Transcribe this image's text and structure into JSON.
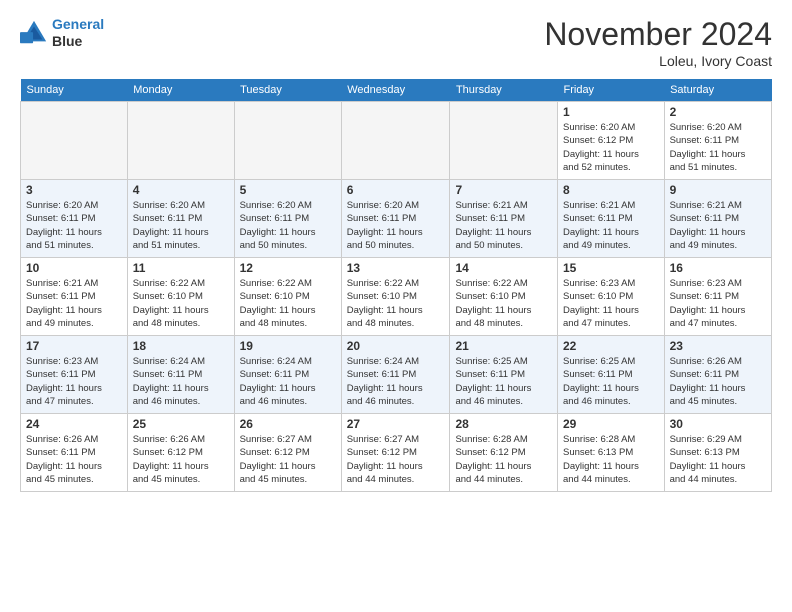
{
  "header": {
    "logo_line1": "General",
    "logo_line2": "Blue",
    "month_title": "November 2024",
    "location": "Loleu, Ivory Coast"
  },
  "weekdays": [
    "Sunday",
    "Monday",
    "Tuesday",
    "Wednesday",
    "Thursday",
    "Friday",
    "Saturday"
  ],
  "weeks": [
    [
      {
        "day": "",
        "info": ""
      },
      {
        "day": "",
        "info": ""
      },
      {
        "day": "",
        "info": ""
      },
      {
        "day": "",
        "info": ""
      },
      {
        "day": "",
        "info": ""
      },
      {
        "day": "1",
        "info": "Sunrise: 6:20 AM\nSunset: 6:12 PM\nDaylight: 11 hours\nand 52 minutes."
      },
      {
        "day": "2",
        "info": "Sunrise: 6:20 AM\nSunset: 6:11 PM\nDaylight: 11 hours\nand 51 minutes."
      }
    ],
    [
      {
        "day": "3",
        "info": "Sunrise: 6:20 AM\nSunset: 6:11 PM\nDaylight: 11 hours\nand 51 minutes."
      },
      {
        "day": "4",
        "info": "Sunrise: 6:20 AM\nSunset: 6:11 PM\nDaylight: 11 hours\nand 51 minutes."
      },
      {
        "day": "5",
        "info": "Sunrise: 6:20 AM\nSunset: 6:11 PM\nDaylight: 11 hours\nand 50 minutes."
      },
      {
        "day": "6",
        "info": "Sunrise: 6:20 AM\nSunset: 6:11 PM\nDaylight: 11 hours\nand 50 minutes."
      },
      {
        "day": "7",
        "info": "Sunrise: 6:21 AM\nSunset: 6:11 PM\nDaylight: 11 hours\nand 50 minutes."
      },
      {
        "day": "8",
        "info": "Sunrise: 6:21 AM\nSunset: 6:11 PM\nDaylight: 11 hours\nand 49 minutes."
      },
      {
        "day": "9",
        "info": "Sunrise: 6:21 AM\nSunset: 6:11 PM\nDaylight: 11 hours\nand 49 minutes."
      }
    ],
    [
      {
        "day": "10",
        "info": "Sunrise: 6:21 AM\nSunset: 6:11 PM\nDaylight: 11 hours\nand 49 minutes."
      },
      {
        "day": "11",
        "info": "Sunrise: 6:22 AM\nSunset: 6:10 PM\nDaylight: 11 hours\nand 48 minutes."
      },
      {
        "day": "12",
        "info": "Sunrise: 6:22 AM\nSunset: 6:10 PM\nDaylight: 11 hours\nand 48 minutes."
      },
      {
        "day": "13",
        "info": "Sunrise: 6:22 AM\nSunset: 6:10 PM\nDaylight: 11 hours\nand 48 minutes."
      },
      {
        "day": "14",
        "info": "Sunrise: 6:22 AM\nSunset: 6:10 PM\nDaylight: 11 hours\nand 48 minutes."
      },
      {
        "day": "15",
        "info": "Sunrise: 6:23 AM\nSunset: 6:10 PM\nDaylight: 11 hours\nand 47 minutes."
      },
      {
        "day": "16",
        "info": "Sunrise: 6:23 AM\nSunset: 6:11 PM\nDaylight: 11 hours\nand 47 minutes."
      }
    ],
    [
      {
        "day": "17",
        "info": "Sunrise: 6:23 AM\nSunset: 6:11 PM\nDaylight: 11 hours\nand 47 minutes."
      },
      {
        "day": "18",
        "info": "Sunrise: 6:24 AM\nSunset: 6:11 PM\nDaylight: 11 hours\nand 46 minutes."
      },
      {
        "day": "19",
        "info": "Sunrise: 6:24 AM\nSunset: 6:11 PM\nDaylight: 11 hours\nand 46 minutes."
      },
      {
        "day": "20",
        "info": "Sunrise: 6:24 AM\nSunset: 6:11 PM\nDaylight: 11 hours\nand 46 minutes."
      },
      {
        "day": "21",
        "info": "Sunrise: 6:25 AM\nSunset: 6:11 PM\nDaylight: 11 hours\nand 46 minutes."
      },
      {
        "day": "22",
        "info": "Sunrise: 6:25 AM\nSunset: 6:11 PM\nDaylight: 11 hours\nand 46 minutes."
      },
      {
        "day": "23",
        "info": "Sunrise: 6:26 AM\nSunset: 6:11 PM\nDaylight: 11 hours\nand 45 minutes."
      }
    ],
    [
      {
        "day": "24",
        "info": "Sunrise: 6:26 AM\nSunset: 6:11 PM\nDaylight: 11 hours\nand 45 minutes."
      },
      {
        "day": "25",
        "info": "Sunrise: 6:26 AM\nSunset: 6:12 PM\nDaylight: 11 hours\nand 45 minutes."
      },
      {
        "day": "26",
        "info": "Sunrise: 6:27 AM\nSunset: 6:12 PM\nDaylight: 11 hours\nand 45 minutes."
      },
      {
        "day": "27",
        "info": "Sunrise: 6:27 AM\nSunset: 6:12 PM\nDaylight: 11 hours\nand 44 minutes."
      },
      {
        "day": "28",
        "info": "Sunrise: 6:28 AM\nSunset: 6:12 PM\nDaylight: 11 hours\nand 44 minutes."
      },
      {
        "day": "29",
        "info": "Sunrise: 6:28 AM\nSunset: 6:13 PM\nDaylight: 11 hours\nand 44 minutes."
      },
      {
        "day": "30",
        "info": "Sunrise: 6:29 AM\nSunset: 6:13 PM\nDaylight: 11 hours\nand 44 minutes."
      }
    ]
  ]
}
